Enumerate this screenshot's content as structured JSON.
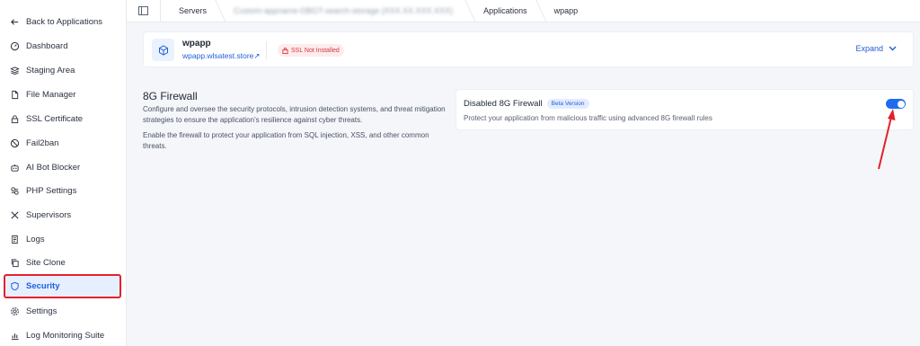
{
  "sidebar": {
    "items": [
      {
        "label": "Back to Applications",
        "icon": "arrow-left-icon"
      },
      {
        "label": "Dashboard",
        "icon": "dashboard-icon"
      },
      {
        "label": "Staging Area",
        "icon": "layers-icon"
      },
      {
        "label": "File Manager",
        "icon": "file-icon"
      },
      {
        "label": "SSL Certificate",
        "icon": "lock-icon"
      },
      {
        "label": "Fail2ban",
        "icon": "ban-icon"
      },
      {
        "label": "AI Bot Blocker",
        "icon": "robot-icon"
      },
      {
        "label": "PHP Settings",
        "icon": "php-icon"
      },
      {
        "label": "Supervisors",
        "icon": "tools-icon"
      },
      {
        "label": "Logs",
        "icon": "log-icon"
      },
      {
        "label": "Site Clone",
        "icon": "copy-icon"
      },
      {
        "label": "Security",
        "icon": "shield-icon",
        "active": true
      },
      {
        "label": "Settings",
        "icon": "gear-icon"
      },
      {
        "label": "Log Monitoring Suite",
        "icon": "chart-icon"
      }
    ]
  },
  "breadcrumb": {
    "servers": "Servers",
    "server_name": "Custom-appname-DBGT-search-storage",
    "server_ip": "(XXX.XX.XXX.XXX)",
    "applications": "Applications",
    "app": "wpapp"
  },
  "app_card": {
    "name": "wpapp",
    "url": "wpapp.wlsatest.store",
    "url_arrow": "↗",
    "ssl_status": "SSL Not Installed",
    "expand_label": "Expand"
  },
  "firewall": {
    "title": "8G Firewall",
    "description": "Configure and oversee the security protocols, intrusion detection systems, and threat mitigation strategies to ensure the application's resilience against cyber threats.",
    "description2": "Enable the firewall to protect your application from SQL injection, XSS, and other common threats.",
    "card_title": "Disabled 8G Firewall",
    "beta_label": "Beta Version",
    "card_description": "Protect your application from malicious traffic using advanced 8G firewall rules",
    "toggle_on": true
  },
  "colors": {
    "accent": "#1e6bf0",
    "highlight_outline": "#e5202b",
    "ssl_badge_text": "#d9343f"
  }
}
